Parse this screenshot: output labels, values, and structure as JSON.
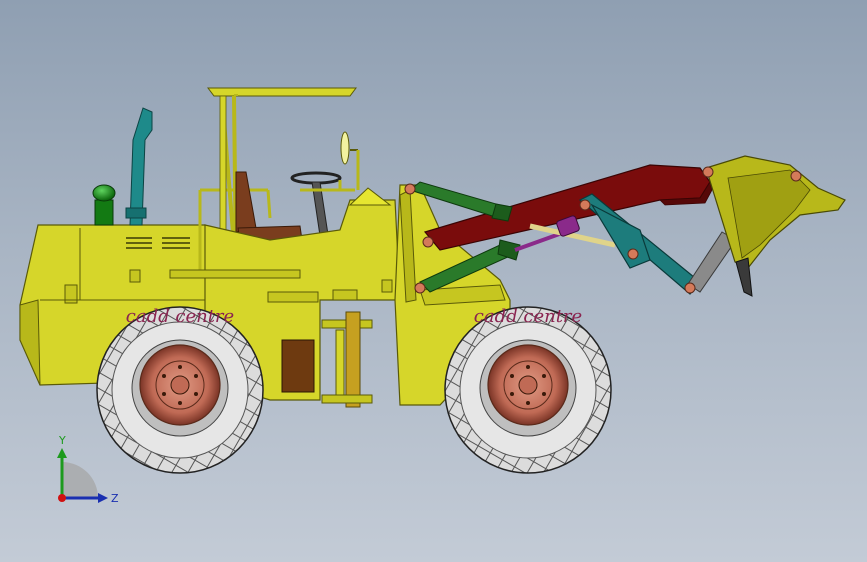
{
  "viewport": {
    "background_top": "#8f9fb2",
    "background_bottom": "#c3cbd6"
  },
  "model": {
    "colors": {
      "body": "#d6d62a",
      "body_dark": "#8c8c10",
      "boom": "#7a0c0c",
      "hydraulic_cylinder": "#2a7a2a",
      "bellcrank": "#1d7c7c",
      "exhaust": "#1e8a8a",
      "seat": "#7a3d1e",
      "tire": "#d9d9d9",
      "tire_tread_text": "#8a2450",
      "rim": "#c06a55",
      "bucket": "#b8b81a",
      "cutting_edge": "#9a9a9a",
      "pin": "#d47a5a"
    },
    "tread_text": "cadd centre",
    "icons": [
      "exhaust-stack-icon",
      "air-cleaner-icon"
    ]
  },
  "triad": {
    "y_label": "Y",
    "z_label": "Z",
    "colors": {
      "y": "#1d9a1d",
      "z": "#1a2fb0",
      "origin": "#d01010"
    }
  }
}
